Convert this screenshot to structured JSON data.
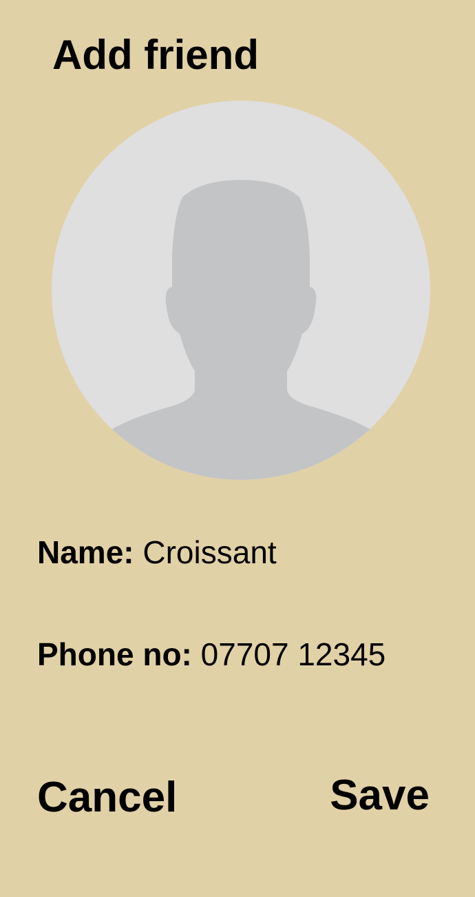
{
  "colors": {
    "background": "#e1d1a6",
    "avatar_circle": "#dfdfe0",
    "avatar_silhouette": "#c3c4c6",
    "text": "#000000"
  },
  "header": {
    "title": "Add friend"
  },
  "avatar": {
    "icon": "default-person-silhouette-icon"
  },
  "fields": {
    "name": {
      "label": "Name:",
      "value": "Croissant"
    },
    "phone": {
      "label": "Phone no:",
      "value": "07707 12345"
    }
  },
  "actions": {
    "cancel_label": "Cancel",
    "save_label": "Save"
  }
}
